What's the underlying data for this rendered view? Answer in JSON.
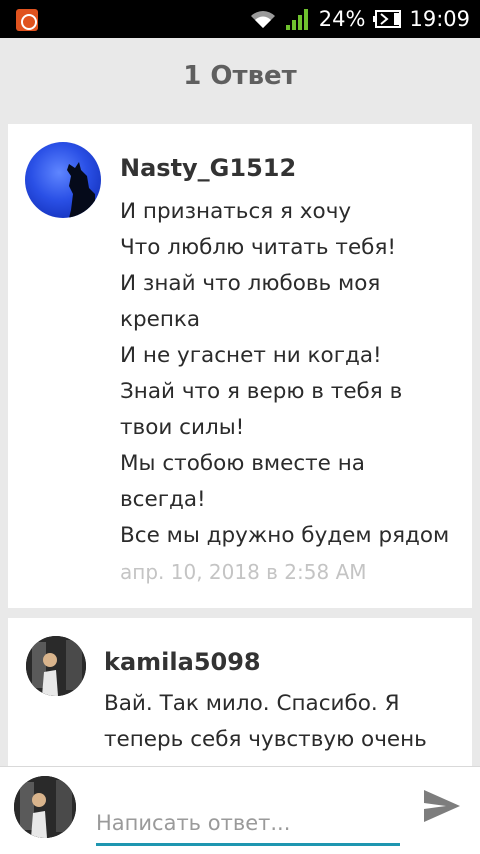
{
  "statusbar": {
    "battery_text": "24%",
    "time": "19:09",
    "icons": [
      "app-notification-icon",
      "wifi-icon",
      "signal-icon",
      "battery-icon"
    ]
  },
  "header": {
    "title": "1 Ответ"
  },
  "comments": [
    {
      "username": "Nasty_G1512",
      "avatar": "wolf-moon-avatar",
      "lines": [
        "И признаться я хочу",
        "Что люблю читать тебя!",
        "И знай что любовь моя",
        "крепка",
        "И не угаснет ни когда!",
        "Знай что я верю в тебя в",
        "твои силы!",
        "Мы стобою вместе на",
        "всегда!",
        "Все мы дружно будем рядом"
      ],
      "timestamp": "апр. 10, 2018 в 2:58 AM"
    },
    {
      "username": "kamila5098",
      "avatar": "girl-photo-avatar",
      "lines": [
        "Вай. Так мило. Спасибо. Я",
        "теперь себя чувствую очень"
      ]
    }
  ],
  "reply": {
    "placeholder": "Написать ответ...",
    "value": ""
  },
  "colors": {
    "accent": "#1e96b0",
    "background": "#e9e9e9",
    "timestamp": "#c4c4c4"
  }
}
